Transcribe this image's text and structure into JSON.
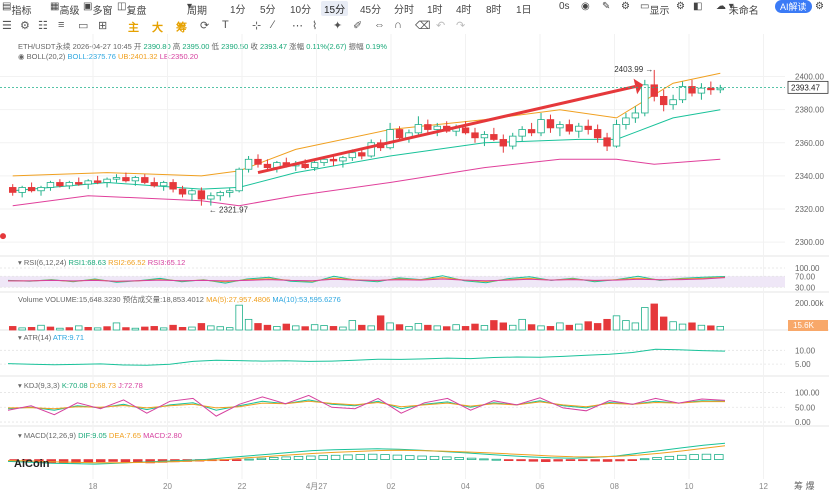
{
  "topbar": {
    "items": [
      "指标",
      "高级",
      "多窗",
      "复盘",
      "周期"
    ],
    "timeframes": [
      "1分",
      "5分",
      "10分",
      "15分",
      "45分",
      "分时",
      "1时",
      "4时",
      "8时",
      "1日"
    ],
    "active_tf": "15分",
    "right": [
      "0s",
      "显示",
      "未命名",
      "AI解读"
    ]
  },
  "toolbar": {
    "zh_buttons": [
      "主",
      "大",
      "筹"
    ]
  },
  "info": {
    "symbol": "ETH/USDT永续",
    "datetime": "2026-04-27 10:45",
    "open_label": "开",
    "open": "2390.80",
    "high_label": "高",
    "high": "2395.00",
    "low_label": "低",
    "low": "2390.50",
    "close_label": "收",
    "close": "2393.47",
    "chg_label": "涨幅",
    "chg": "0.11%(2.67)",
    "amp_label": "振幅",
    "amp": "0.19%"
  },
  "boll": {
    "name": "BOLL(20,2)",
    "mid": "BOLL:2375.76",
    "up": "UB:2401.32",
    "low": "LB:2350.20"
  },
  "rsi": {
    "name": "RSI(6,12,24)",
    "v1": "RSI1:68.63",
    "v2": "RSI2:66.52",
    "v3": "RSI3:65.12"
  },
  "volume": {
    "name": "Volume",
    "vol": "VOLUME:15,648.3230",
    "est": "预估成交量:18,853.4012",
    "ma5": "MA(5):27,957.4806",
    "ma10": "MA(10):53,595.6276"
  },
  "atr": {
    "name": "ATR(14)",
    "v": "ATR:9.71"
  },
  "kdj": {
    "name": "KDJ(9,3,3)",
    "k": "K:70.08",
    "d": "D:68.73",
    "j": "J:72.78"
  },
  "macd": {
    "name": "MACD(12,26,9)",
    "dif": "DIF:9.05",
    "dea": "DEA:7.65",
    "macd": "MACD:2.80"
  },
  "annotations": {
    "high": "2403.99",
    "low": "2321.97",
    "last_price": "2393.47",
    "vol_last": "15.6K"
  },
  "logo": "AiCoin",
  "corner": "筹 爆",
  "chart_data": [
    {
      "type": "candlestick",
      "title": "ETH/USDT永续 15分",
      "x_ticks": [
        "18",
        "20",
        "22",
        "4月27",
        "02",
        "04",
        "06",
        "08",
        "10",
        "12"
      ],
      "y_ticks": [
        2300,
        2320,
        2340,
        2360,
        2380,
        2400
      ],
      "ylim": [
        2294,
        2410
      ],
      "ohlc": [
        [
          2333,
          2335,
          2328,
          2330
        ],
        [
          2330,
          2334,
          2327,
          2333
        ],
        [
          2333,
          2336,
          2330,
          2331
        ],
        [
          2331,
          2334,
          2328,
          2333
        ],
        [
          2333,
          2337,
          2331,
          2336
        ],
        [
          2336,
          2338,
          2333,
          2334
        ],
        [
          2334,
          2337,
          2332,
          2336
        ],
        [
          2336,
          2339,
          2334,
          2335
        ],
        [
          2335,
          2338,
          2332,
          2337
        ],
        [
          2337,
          2340,
          2335,
          2336
        ],
        [
          2336,
          2339,
          2333,
          2338
        ],
        [
          2338,
          2341,
          2336,
          2339
        ],
        [
          2339,
          2342,
          2336,
          2337
        ],
        [
          2337,
          2340,
          2334,
          2339
        ],
        [
          2339,
          2341,
          2335,
          2336
        ],
        [
          2336,
          2339,
          2333,
          2334
        ],
        [
          2334,
          2337,
          2331,
          2336
        ],
        [
          2336,
          2338,
          2330,
          2332
        ],
        [
          2332,
          2334,
          2327,
          2329
        ],
        [
          2329,
          2332,
          2325,
          2331
        ],
        [
          2331,
          2333,
          2322,
          2326
        ],
        [
          2326,
          2330,
          2322,
          2328
        ],
        [
          2328,
          2331,
          2325,
          2330
        ],
        [
          2330,
          2333,
          2327,
          2331
        ],
        [
          2331,
          2345,
          2330,
          2344
        ],
        [
          2344,
          2352,
          2342,
          2350
        ],
        [
          2350,
          2353,
          2345,
          2347
        ],
        [
          2347,
          2350,
          2343,
          2345
        ],
        [
          2345,
          2349,
          2342,
          2348
        ],
        [
          2348,
          2351,
          2345,
          2346
        ],
        [
          2346,
          2349,
          2343,
          2347
        ],
        [
          2347,
          2350,
          2344,
          2345
        ],
        [
          2345,
          2349,
          2343,
          2348
        ],
        [
          2348,
          2352,
          2346,
          2350
        ],
        [
          2350,
          2353,
          2346,
          2349
        ],
        [
          2349,
          2352,
          2345,
          2351
        ],
        [
          2351,
          2356,
          2349,
          2354
        ],
        [
          2354,
          2357,
          2350,
          2352
        ],
        [
          2352,
          2362,
          2351,
          2360
        ],
        [
          2360,
          2362,
          2355,
          2357
        ],
        [
          2357,
          2372,
          2356,
          2368
        ],
        [
          2368,
          2370,
          2361,
          2363
        ],
        [
          2363,
          2368,
          2360,
          2366
        ],
        [
          2366,
          2376,
          2364,
          2371
        ],
        [
          2371,
          2374,
          2366,
          2368
        ],
        [
          2368,
          2372,
          2364,
          2370
        ],
        [
          2370,
          2373,
          2366,
          2367
        ],
        [
          2367,
          2371,
          2364,
          2369
        ],
        [
          2369,
          2373,
          2365,
          2366
        ],
        [
          2366,
          2369,
          2360,
          2363
        ],
        [
          2363,
          2367,
          2358,
          2365
        ],
        [
          2365,
          2369,
          2361,
          2362
        ],
        [
          2362,
          2365,
          2354,
          2358
        ],
        [
          2358,
          2366,
          2356,
          2364
        ],
        [
          2364,
          2370,
          2361,
          2368
        ],
        [
          2368,
          2372,
          2364,
          2366
        ],
        [
          2366,
          2378,
          2364,
          2374
        ],
        [
          2374,
          2377,
          2366,
          2369
        ],
        [
          2369,
          2373,
          2364,
          2371
        ],
        [
          2371,
          2374,
          2365,
          2367
        ],
        [
          2367,
          2372,
          2363,
          2370
        ],
        [
          2370,
          2374,
          2365,
          2368
        ],
        [
          2368,
          2371,
          2360,
          2363
        ],
        [
          2363,
          2366,
          2355,
          2358
        ],
        [
          2358,
          2374,
          2357,
          2371
        ],
        [
          2371,
          2378,
          2368,
          2375
        ],
        [
          2375,
          2382,
          2372,
          2378
        ],
        [
          2378,
          2398,
          2376,
          2395
        ],
        [
          2395,
          2404,
          2385,
          2388
        ],
        [
          2388,
          2392,
          2379,
          2383
        ],
        [
          2383,
          2389,
          2380,
          2386
        ],
        [
          2386,
          2397,
          2384,
          2394
        ],
        [
          2394,
          2398,
          2388,
          2390
        ],
        [
          2390,
          2396,
          2386,
          2393
        ],
        [
          2393,
          2397,
          2389,
          2392
        ],
        [
          2392,
          2395,
          2390,
          2393
        ]
      ],
      "boll_mid_points": [
        [
          0,
          2331
        ],
        [
          10,
          2336
        ],
        [
          20,
          2332
        ],
        [
          24,
          2333
        ],
        [
          30,
          2342
        ],
        [
          40,
          2352
        ],
        [
          50,
          2360
        ],
        [
          60,
          2362
        ],
        [
          64,
          2362
        ],
        [
          70,
          2375
        ],
        [
          75,
          2380
        ]
      ],
      "boll_up_points": [
        [
          0,
          2340
        ],
        [
          10,
          2342
        ],
        [
          20,
          2340
        ],
        [
          24,
          2343
        ],
        [
          30,
          2356
        ],
        [
          40,
          2368
        ],
        [
          50,
          2374
        ],
        [
          58,
          2380
        ],
        [
          64,
          2375
        ],
        [
          70,
          2396
        ],
        [
          75,
          2402
        ]
      ],
      "boll_low_points": [
        [
          0,
          2322
        ],
        [
          8,
          2328
        ],
        [
          20,
          2325
        ],
        [
          24,
          2322
        ],
        [
          30,
          2328
        ],
        [
          40,
          2336
        ],
        [
          50,
          2345
        ],
        [
          58,
          2350
        ],
        [
          64,
          2350
        ],
        [
          68,
          2347
        ],
        [
          75,
          2350
        ]
      ],
      "high_marker": {
        "index": 68,
        "value": 2403.99
      },
      "low_marker": {
        "index": 21,
        "value": 2321.97
      },
      "last_price": 2393.47
    },
    {
      "type": "line",
      "title": "RSI(6,12,24)",
      "y_ticks": [
        30,
        70,
        100
      ],
      "ylim": [
        20,
        100
      ],
      "series": [
        {
          "name": "RSI1",
          "values": [
            55,
            52,
            58,
            50,
            60,
            48,
            54,
            62,
            50,
            57,
            45,
            60,
            66,
            52,
            48,
            70,
            56,
            50,
            64,
            58,
            72,
            54,
            46,
            61,
            68,
            55,
            63,
            50,
            58,
            70,
            55,
            62,
            66,
            69
          ]
        },
        {
          "name": "RSI2",
          "values": [
            54,
            53,
            56,
            52,
            57,
            51,
            54,
            58,
            53,
            56,
            50,
            57,
            61,
            55,
            52,
            63,
            57,
            54,
            60,
            57,
            65,
            56,
            51,
            58,
            62,
            56,
            60,
            54,
            57,
            63,
            57,
            60,
            62,
            66
          ]
        },
        {
          "name": "RSI3",
          "values": [
            53,
            53,
            55,
            53,
            55,
            52,
            54,
            56,
            54,
            55,
            53,
            55,
            58,
            55,
            54,
            59,
            56,
            55,
            57,
            56,
            60,
            56,
            54,
            56,
            59,
            56,
            58,
            55,
            56,
            59,
            57,
            58,
            60,
            65
          ]
        }
      ]
    },
    {
      "type": "bar",
      "title": "Volume",
      "y_ticks": [
        200000
      ],
      "ylim": [
        0,
        300000
      ],
      "values": [
        30,
        18,
        22,
        40,
        25,
        15,
        20,
        35,
        22,
        18,
        28,
        60,
        20,
        15,
        25,
        30,
        18,
        40,
        22,
        25,
        55,
        35,
        28,
        20,
        210,
        90,
        55,
        40,
        30,
        50,
        35,
        28,
        45,
        38,
        30,
        25,
        80,
        40,
        35,
        120,
        60,
        45,
        30,
        55,
        40,
        35,
        28,
        45,
        30,
        50,
        38,
        80,
        60,
        40,
        90,
        45,
        35,
        30,
        60,
        40,
        50,
        70,
        55,
        90,
        120,
        80,
        60,
        190,
        220,
        110,
        70,
        50,
        60,
        40,
        35,
        30
      ],
      "up": [
        false,
        true,
        false,
        true,
        false,
        true,
        false,
        true,
        false,
        true,
        false,
        true,
        false,
        true,
        false,
        false,
        true,
        false,
        false,
        true,
        false,
        true,
        true,
        true,
        true,
        true,
        false,
        false,
        true,
        false,
        true,
        false,
        true,
        true,
        false,
        true,
        true,
        false,
        true,
        false,
        true,
        false,
        true,
        true,
        false,
        true,
        false,
        true,
        false,
        false,
        true,
        false,
        false,
        true,
        true,
        false,
        true,
        false,
        true,
        false,
        true,
        false,
        false,
        false,
        true,
        true,
        true,
        true,
        false,
        false,
        true,
        true,
        false,
        true,
        false,
        true
      ]
    },
    {
      "type": "line",
      "title": "ATR(14)",
      "y_ticks": [
        5.0,
        10.0
      ],
      "ylim": [
        0,
        13
      ],
      "series": [
        {
          "name": "ATR",
          "values": [
            5.2,
            5.0,
            4.8,
            4.9,
            5.1,
            4.7,
            4.6,
            5.0,
            6.0,
            6.4,
            6.3,
            6.1,
            6.2,
            6.0,
            6.1,
            6.4,
            6.8,
            6.7,
            6.9,
            7.2,
            7.0,
            7.4,
            7.6,
            7.5,
            7.8,
            8.2,
            8.6,
            9.2,
            10.4,
            10.2,
            9.9,
            9.71
          ]
        }
      ]
    },
    {
      "type": "line",
      "title": "KDJ(9,3,3)",
      "y_ticks": [
        0,
        50,
        100
      ],
      "ylim": [
        -20,
        115
      ],
      "series": [
        {
          "name": "K",
          "values": [
            45,
            50,
            40,
            55,
            48,
            60,
            42,
            58,
            65,
            40,
            55,
            70,
            62,
            75,
            60,
            55,
            70,
            45,
            60,
            68,
            50,
            65,
            58,
            72,
            55,
            48,
            66,
            60,
            70,
            64,
            72,
            70
          ]
        },
        {
          "name": "D",
          "values": [
            48,
            49,
            45,
            52,
            50,
            56,
            48,
            55,
            60,
            48,
            52,
            64,
            62,
            70,
            63,
            58,
            66,
            52,
            58,
            64,
            54,
            62,
            58,
            68,
            58,
            52,
            63,
            60,
            66,
            64,
            69,
            69
          ]
        },
        {
          "name": "J",
          "values": [
            40,
            55,
            25,
            65,
            45,
            75,
            30,
            70,
            80,
            20,
            60,
            85,
            62,
            90,
            50,
            45,
            80,
            30,
            65,
            80,
            40,
            72,
            58,
            82,
            48,
            38,
            72,
            60,
            80,
            64,
            78,
            73
          ]
        }
      ]
    },
    {
      "type": "bar",
      "title": "MACD(12,26,9)",
      "ylim": [
        -8,
        12
      ],
      "values": [
        -1,
        -1.2,
        -1.5,
        -1.8,
        -2,
        -1.8,
        -1.5,
        -1.2,
        -1,
        -1.3,
        -1.6,
        -1.8,
        -1.5,
        -1.2,
        -1,
        -0.8,
        -0.6,
        -0.4,
        -0.2,
        0.3,
        0.8,
        1.2,
        1.5,
        1.8,
        2.0,
        2.2,
        2.4,
        2.6,
        2.8,
        3.0,
        2.8,
        2.5,
        2.2,
        2.0,
        1.8,
        1.5,
        1.2,
        0.8,
        0.4,
        0.2,
        -0.3,
        -0.6,
        -0.9,
        -1.1,
        -0.8,
        -0.5,
        -0.6,
        -0.8,
        -1,
        -0.7,
        -0.3,
        0.5,
        1.2,
        1.8,
        2.4,
        2.8,
        3.0,
        2.8
      ],
      "series": [
        {
          "name": "DIF",
          "values": [
            -1,
            -1.5,
            -2,
            -2.2,
            -2.5,
            -2,
            -1.5,
            -1,
            -0.5,
            0,
            1,
            2,
            3,
            4,
            5,
            5.5,
            5.8,
            6,
            5.8,
            5.2,
            4.5,
            3.8,
            3,
            2.2,
            1.5,
            1,
            0.8,
            1.2,
            2,
            3.5,
            5,
            6.5,
            8,
            9.05
          ]
        },
        {
          "name": "DEA",
          "values": [
            -0.5,
            -0.8,
            -1.2,
            -1.5,
            -1.8,
            -1.8,
            -1.6,
            -1.4,
            -1,
            -0.5,
            0,
            1,
            1.8,
            2.6,
            3.4,
            4,
            4.5,
            5,
            5.2,
            5,
            4.7,
            4.3,
            3.8,
            3.2,
            2.6,
            2,
            1.6,
            1.5,
            1.8,
            2.5,
            3.5,
            4.8,
            6.2,
            7.65
          ]
        }
      ]
    }
  ]
}
